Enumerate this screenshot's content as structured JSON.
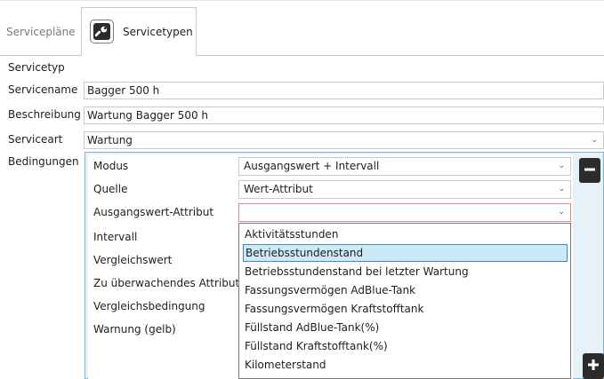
{
  "tabs": [
    {
      "label": "Servicepläne"
    },
    {
      "label": "Servicetypen"
    }
  ],
  "form": {
    "section_label": "Servicetyp",
    "name_label": "Servicename",
    "name_value": "Bagger 500 h",
    "description_label": "Beschreibung",
    "description_value": "Wartung Bagger 500 h",
    "type_label": "Serviceart",
    "type_value": "Wartung",
    "conditions_label": "Bedingungen"
  },
  "conditions": {
    "rows": [
      {
        "label": "Modus",
        "value": "Ausgangswert + Intervall"
      },
      {
        "label": "Quelle",
        "value": "Wert-Attribut"
      },
      {
        "label": "Ausgangswert-Attribut",
        "value": ""
      },
      {
        "label": "Intervall"
      },
      {
        "label": "Vergleichswert"
      },
      {
        "label": "Zu überwachendes Attribut"
      },
      {
        "label": "Vergleichsbedingung"
      },
      {
        "label": "Warnung (gelb)"
      }
    ],
    "dropdown_options": [
      "Aktivitätsstunden",
      "Betriebsstundenstand",
      "Betriebsstundenstand bei letzter Wartung",
      "Fassungsvermögen AdBlue-Tank",
      "Fassungsvermögen Kraftstofftank",
      "Füllstand AdBlue-Tank(%)",
      "Füllstand Kraftstofftank(%)",
      "Kilometerstand"
    ],
    "highlighted_option": "Betriebsstundenstand"
  },
  "icons": {
    "tab_icon": "wrench-icon",
    "remove_button_icon": "minus-icon",
    "add_button_icon": "plus-icon",
    "dropdown_caret": "chevron-down-icon"
  },
  "colors": {
    "selection_bg": "#cde8f7",
    "selection_border": "#3b8bd0",
    "panel_bg": "#e7f1f8",
    "panel_border": "#7fb3d5",
    "error_border": "#e08a8a"
  }
}
